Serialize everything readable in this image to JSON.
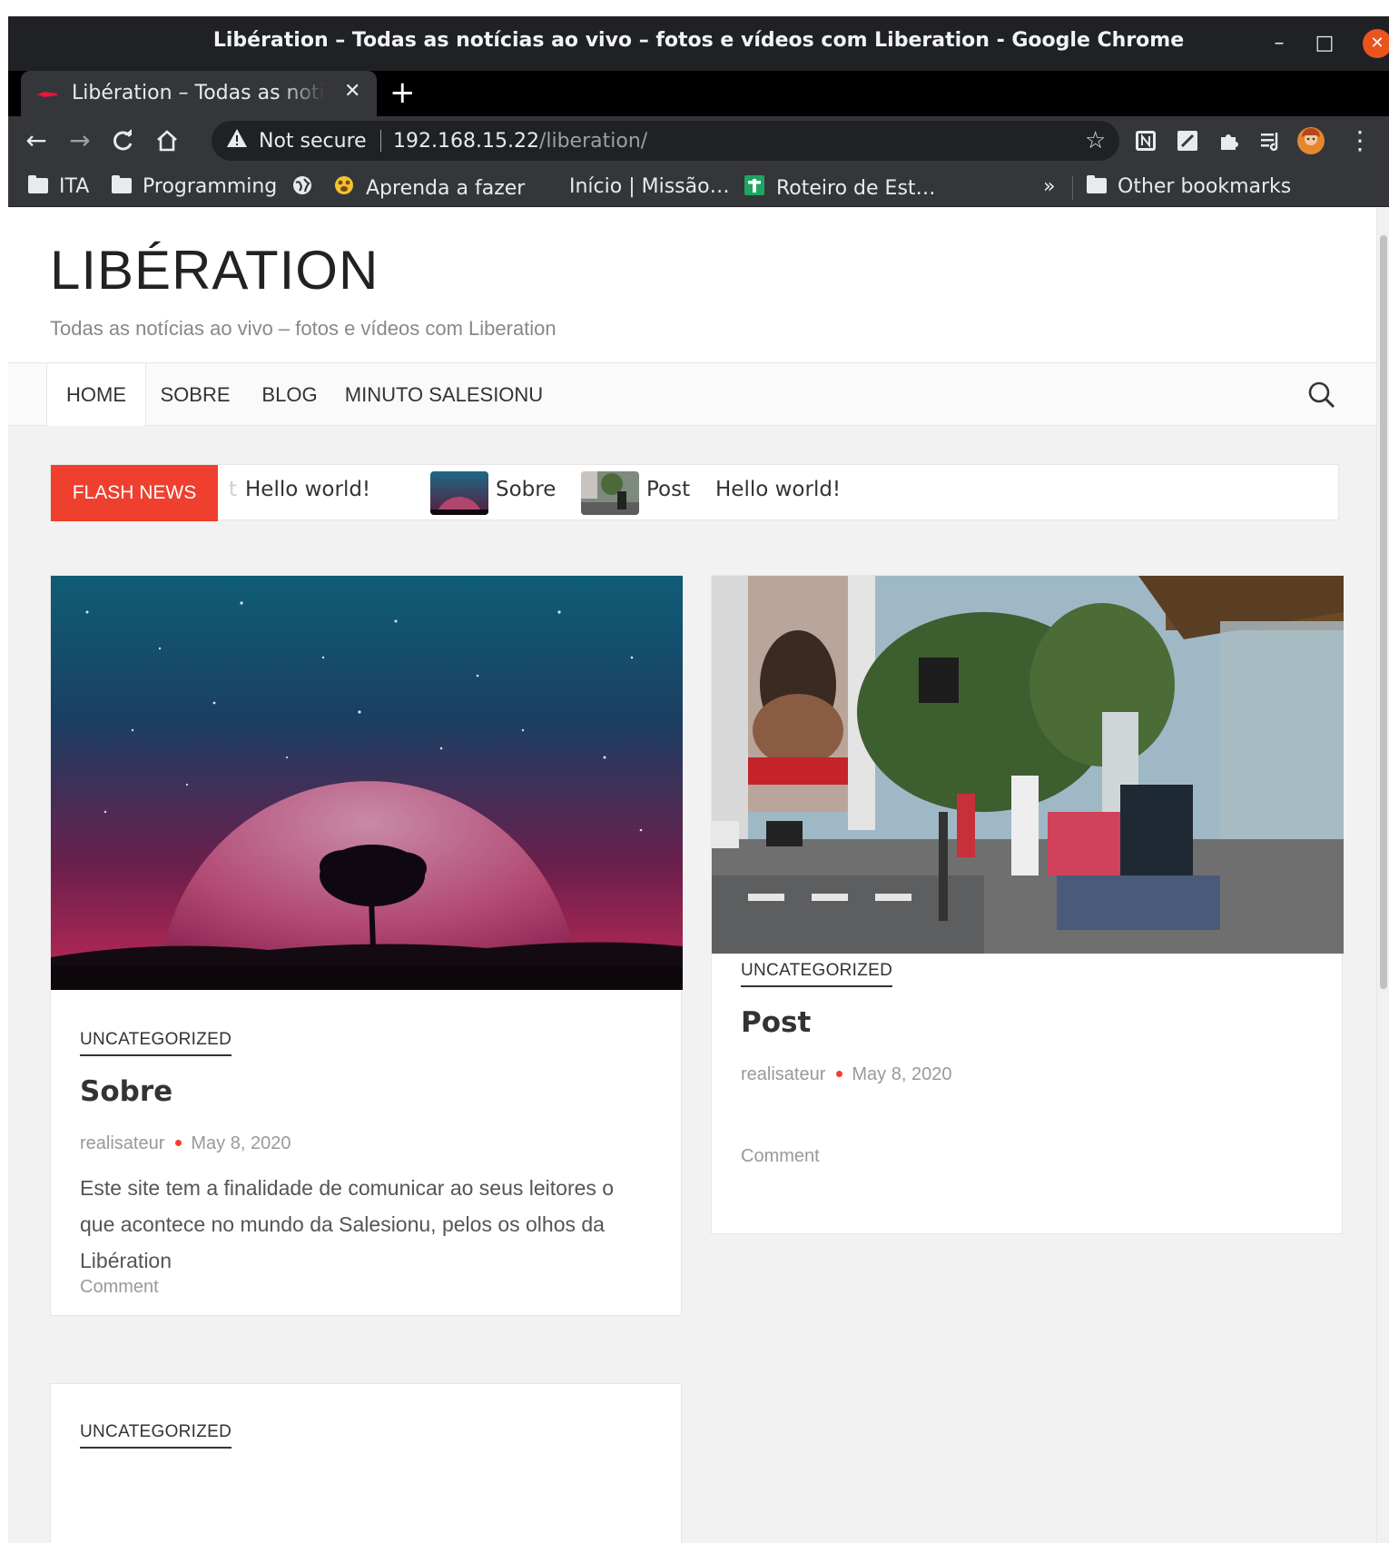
{
  "window": {
    "title": "Libération – Todas as notícias ao vivo – fotos e vídeos com Liberation - Google Chrome",
    "minimize_glyph": "–",
    "maximize_glyph": "□",
    "close_glyph": "✕"
  },
  "tabs": [
    {
      "title": "Libération – Todas as notícias ao vivo",
      "close_glyph": "✕"
    }
  ],
  "new_tab_glyph": "+",
  "toolbar": {
    "back_glyph": "←",
    "forward_glyph": "→",
    "reload_glyph": "C",
    "home_glyph": "⌂",
    "security_glyph": "▲",
    "security_label": "Not secure",
    "url_host": "192.168.15.22",
    "url_path": "/liberation/",
    "star_glyph": "☆",
    "menu_glyph": "⋮"
  },
  "bookmarks": {
    "items": [
      {
        "label": "ITA",
        "icon": "folder-icon"
      },
      {
        "label": "Programming",
        "icon": "folder-icon"
      },
      {
        "label": "",
        "icon": "globe-icon"
      },
      {
        "label": "Aprenda a fazer",
        "icon": "pets-icon"
      },
      {
        "label": "Início | Missão…",
        "icon": ""
      },
      {
        "label": "Roteiro de Est…",
        "icon": "plus-green-icon"
      }
    ],
    "overflow_glyph": "»",
    "other_label": "Other bookmarks"
  },
  "site": {
    "title": "LIBÉRATION",
    "description": "Todas as notícias ao vivo – fotos e vídeos com Liberation"
  },
  "nav": {
    "items": [
      "HOME",
      "SOBRE",
      "BLOG",
      "MINUTO SALESIONU"
    ]
  },
  "ticker": {
    "label": "FLASH NEWS",
    "ghost": "t",
    "items": [
      "Hello world!",
      "Sobre",
      "Post",
      "Hello world!"
    ]
  },
  "posts": [
    {
      "category": "UNCATEGORIZED",
      "title": "Sobre",
      "author": "realisateur",
      "date": "May 8, 2020",
      "excerpt": "Este site tem a finalidade de comunicar ao seus leitores o que acontece no mundo da Salesionu, pelos os olhos da Libération",
      "comment": "Comment"
    },
    {
      "category": "UNCATEGORIZED",
      "title": "Post",
      "author": "realisateur",
      "date": "May 8, 2020",
      "comment": "Comment"
    },
    {
      "category": "UNCATEGORIZED"
    }
  ],
  "colors": {
    "accent": "#ef3f2e",
    "chrome_dark": "#202124",
    "chrome_toolbar": "#35363a"
  }
}
